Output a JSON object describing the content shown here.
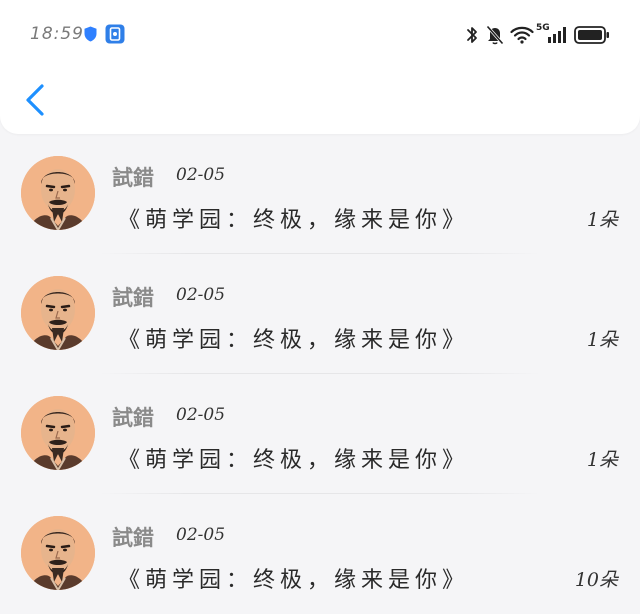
{
  "status_bar": {
    "time": "18:59",
    "icons": [
      "shield-icon",
      "app-icon",
      "bluetooth-icon",
      "mute-bell-icon",
      "wifi-icon",
      "signal-5g-icon",
      "battery-icon"
    ],
    "network_label": "5G"
  },
  "nav": {
    "back_icon": "chevron-left-icon"
  },
  "colors": {
    "accent": "#1e90ff",
    "name_gray": "#8a8a8a",
    "text_dark": "#2a2a2a",
    "background": "#f5f5f7"
  },
  "records": [
    {
      "name": "試錯",
      "date": "02-05",
      "title": "《萌学园：终极，缘来是你》",
      "count": "1朵"
    },
    {
      "name": "試錯",
      "date": "02-05",
      "title": "《萌学园：终极，缘来是你》",
      "count": "1朵"
    },
    {
      "name": "試錯",
      "date": "02-05",
      "title": "《萌学园：终极，缘来是你》",
      "count": "1朵"
    },
    {
      "name": "試錯",
      "date": "02-05",
      "title": "《萌学园：终极，缘来是你》",
      "count": "10朵"
    }
  ]
}
